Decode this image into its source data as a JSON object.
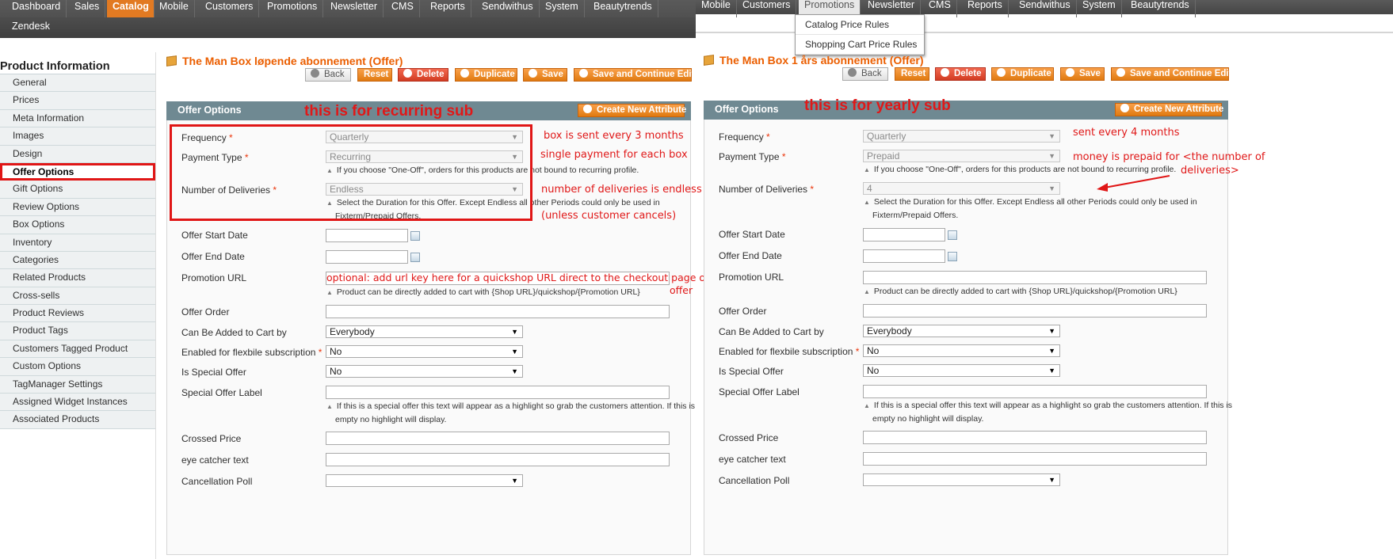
{
  "nav_left": {
    "items": [
      "Dashboard",
      "Sales",
      "Catalog",
      "Mobile",
      "Customers",
      "Promotions",
      "Newsletter",
      "CMS",
      "Reports",
      "Sendwithus",
      "System",
      "Beautytrends"
    ],
    "row2": [
      "Zendesk"
    ]
  },
  "nav_right": {
    "items": [
      "Mobile",
      "Customers",
      "Promotions",
      "Newsletter",
      "CMS",
      "Reports",
      "Sendwithus",
      "System",
      "Beautytrends"
    ],
    "dropdown": [
      "Catalog Price Rules",
      "Shopping Cart Price Rules"
    ]
  },
  "sidebar": {
    "title": "Product Information",
    "items": [
      "General",
      "Prices",
      "Meta Information",
      "Images",
      "Design",
      "Offer Options",
      "Gift Options",
      "Review Options",
      "Box Options",
      "Inventory",
      "Categories",
      "Related Products",
      "Cross-sells",
      "Product Reviews",
      "Product Tags",
      "Customers Tagged Product",
      "Custom Options",
      "TagManager Settings",
      "Assigned Widget Instances",
      "Associated Products"
    ],
    "active": "Offer Options"
  },
  "buttons": {
    "back": "Back",
    "reset": "Reset",
    "delete": "Delete",
    "duplicate": "Duplicate",
    "save": "Save",
    "save_continue": "Save and Continue Edit",
    "create_attr": "Create New Attribute"
  },
  "section_title": "Offer Options",
  "labels": {
    "frequency": "Frequency",
    "payment_type": "Payment Type",
    "num_deliveries": "Number of Deliveries",
    "start_date": "Offer Start Date",
    "end_date": "Offer End Date",
    "promo_url": "Promotion URL",
    "offer_order": "Offer Order",
    "added_by": "Can Be Added to Cart by",
    "flexible": "Enabled for flexbile subscription",
    "special": "Is Special Offer",
    "special_label": "Special Offer Label",
    "crossed": "Crossed Price",
    "eye_catcher": "eye catcher text",
    "cancel_poll": "Cancellation Poll",
    "required_mark": "*"
  },
  "notes": {
    "payment": "If you choose \"One-Off\", orders for this products are not bound to recurring profile.",
    "duration_1": "Select the Duration for this Offer. Except Endless all other Periods could only be used in",
    "duration_2": "Fixterm/Prepaid Offers.",
    "promo": "Product can be directly added to cart with {Shop URL}/quickshop/{Promotion URL}",
    "special_1": "If this is a special offer this text will appear as a highlight so grab the customers attention. If this is",
    "special_2": "empty no highlight will display."
  },
  "left_panel": {
    "title": "The Man Box løpende abonnement (Offer)",
    "frequency": "Quarterly",
    "payment_type": "Recurring",
    "num_deliveries": "Endless",
    "added_by": "Everybody",
    "flexible": "No",
    "special": "No",
    "annotations": {
      "heading": "this is for recurring sub",
      "frequency": "box is sent every 3 months",
      "payment": "single payment for each box",
      "deliveries_1": "number of deliveries is endless",
      "deliveries_2": "(unless customer cancels)",
      "promo_1": "optional: add url key here for a quickshop URL direct to the checkout page of this",
      "promo_2": "offer"
    }
  },
  "right_panel": {
    "title": "The Man Box 1 års abonnement (Offer)",
    "frequency": "Quarterly",
    "payment_type": "Prepaid",
    "num_deliveries": "4",
    "added_by": "Everybody",
    "flexible": "No",
    "special": "No",
    "annotations": {
      "heading": "this is for yearly sub",
      "frequency": "sent every 4 months",
      "payment_1": "money is prepaid for <the number of",
      "payment_2": "deliveries>"
    }
  },
  "colors": {
    "accent": "#e27a22",
    "annotation": "#e01616",
    "title_orange": "#eb5e00",
    "section_head": "#6f8992"
  }
}
